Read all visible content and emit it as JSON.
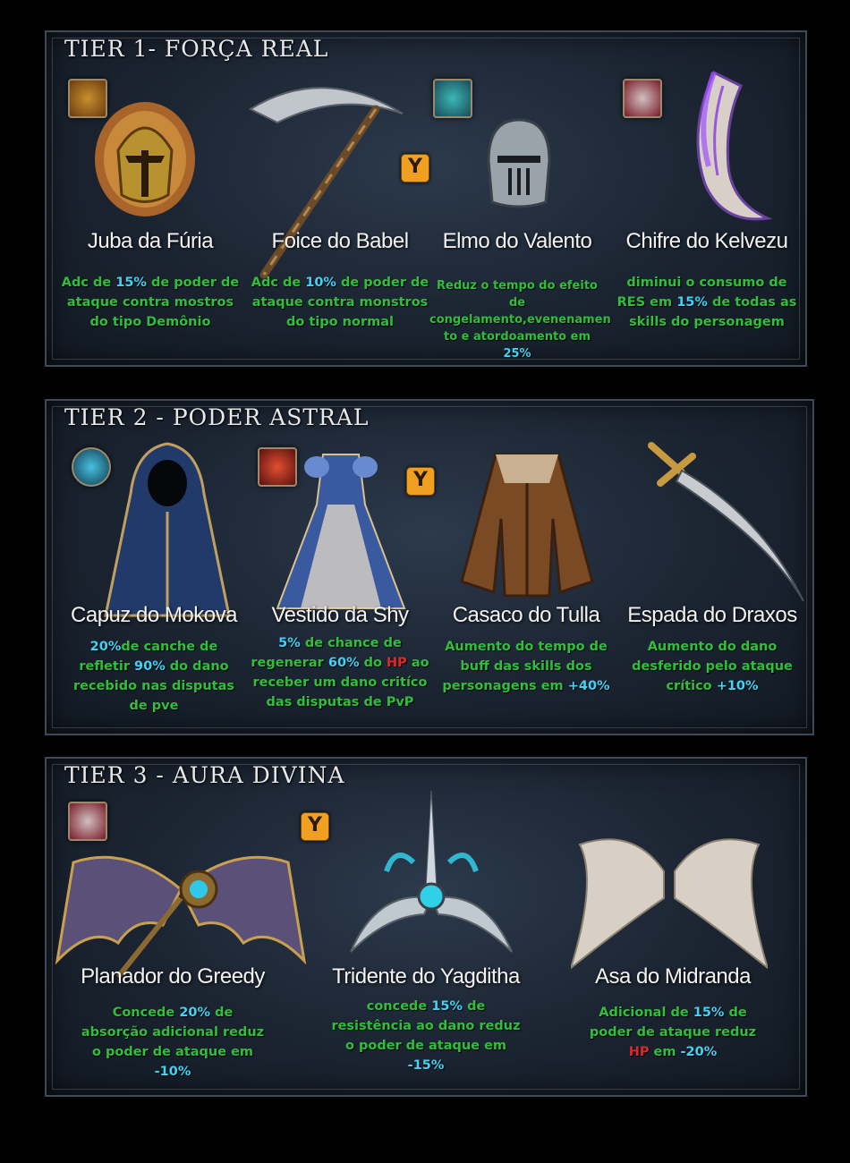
{
  "tiers": [
    {
      "title": "TIER 1- FORÇA REAL",
      "items": [
        {
          "name": "Juba da Fúria",
          "desc": [
            {
              "t": "Adc de "
            },
            {
              "t": "15%",
              "c": "hl"
            },
            {
              "t": " de poder de ataque contra mostros do tipo Demônio"
            }
          ]
        },
        {
          "name": "Foice do Babel",
          "desc": [
            {
              "t": "Adc de "
            },
            {
              "t": "10%",
              "c": "hl"
            },
            {
              "t": " de poder de ataque contra monstros do tipo normal"
            }
          ]
        },
        {
          "name": "Elmo do Valento",
          "desc": [
            {
              "t": "Reduz o tempo do efeito de congelamento,evenenamen to e atordoamento em "
            },
            {
              "t": "25%",
              "c": "hl"
            }
          ]
        },
        {
          "name": "Chifre do Kelvezu",
          "desc": [
            {
              "t": "diminui o consumo de RES em "
            },
            {
              "t": "15%",
              "c": "hl"
            },
            {
              "t": " de todas as skills do personagem"
            }
          ]
        }
      ]
    },
    {
      "title": "TIER 2 - PODER ASTRAL",
      "items": [
        {
          "name": "Capuz do Mokova",
          "desc": [
            {
              "t": "20%",
              "c": "hl"
            },
            {
              "t": "de canche de refletir "
            },
            {
              "t": "90%",
              "c": "hl"
            },
            {
              "t": " do dano recebido nas disputas de pve"
            }
          ]
        },
        {
          "name": "Vestido da Shy",
          "desc": [
            {
              "t": "5%",
              "c": "hl"
            },
            {
              "t": " de chance de regenerar "
            },
            {
              "t": "60%",
              "c": "hl"
            },
            {
              "t": " do "
            },
            {
              "t": "HP",
              "c": "red"
            },
            {
              "t": " ao receber um dano critíco das disputas de PvP"
            }
          ]
        },
        {
          "name": "Casaco do Tulla",
          "desc": [
            {
              "t": "Aumento do tempo de buff das skills dos personagens em "
            },
            {
              "t": "+40%",
              "c": "hl"
            }
          ]
        },
        {
          "name": "Espada do Draxos",
          "desc": [
            {
              "t": "Aumento do dano desferido pelo ataque crítico "
            },
            {
              "t": "+10%",
              "c": "hl"
            }
          ]
        }
      ]
    },
    {
      "title": "TIER 3 - AURA DIVINA",
      "items": [
        {
          "name": "Planador do Greedy",
          "desc": [
            {
              "t": "Concede "
            },
            {
              "t": "20%",
              "c": "hl"
            },
            {
              "t": " de absorção adicional reduz o poder de ataque em "
            },
            {
              "t": "-10%",
              "c": "hl"
            }
          ]
        },
        {
          "name": "Tridente do Yagditha",
          "desc": [
            {
              "t": "concede "
            },
            {
              "t": "15%",
              "c": "hl"
            },
            {
              "t": " de resistência ao dano reduz o poder de ataque em "
            },
            {
              "t": "-15%",
              "c": "hl"
            }
          ]
        },
        {
          "name": "Asa do Midranda",
          "desc": [
            {
              "t": "Adicional de "
            },
            {
              "t": "15%",
              "c": "hl"
            },
            {
              "t": " de poder de ataque reduz "
            },
            {
              "t": "HP",
              "c": "red"
            },
            {
              "t": " em "
            },
            {
              "t": "-20%",
              "c": "hl"
            }
          ]
        }
      ]
    }
  ],
  "y_badge": "Y",
  "colors": {
    "text_green": "#2fbf3a",
    "highlight_cyan": "#3fd3f5",
    "highlight_red": "#e02828",
    "badge_orange": "#f0a020"
  },
  "icons": [
    "lion-helmet-icon",
    "scythe-icon",
    "knight-helmet-icon",
    "horn-icon",
    "cloak-icon",
    "dress-icon",
    "coat-icon",
    "sword-icon",
    "glider-icon",
    "trident-icon",
    "wings-icon"
  ]
}
